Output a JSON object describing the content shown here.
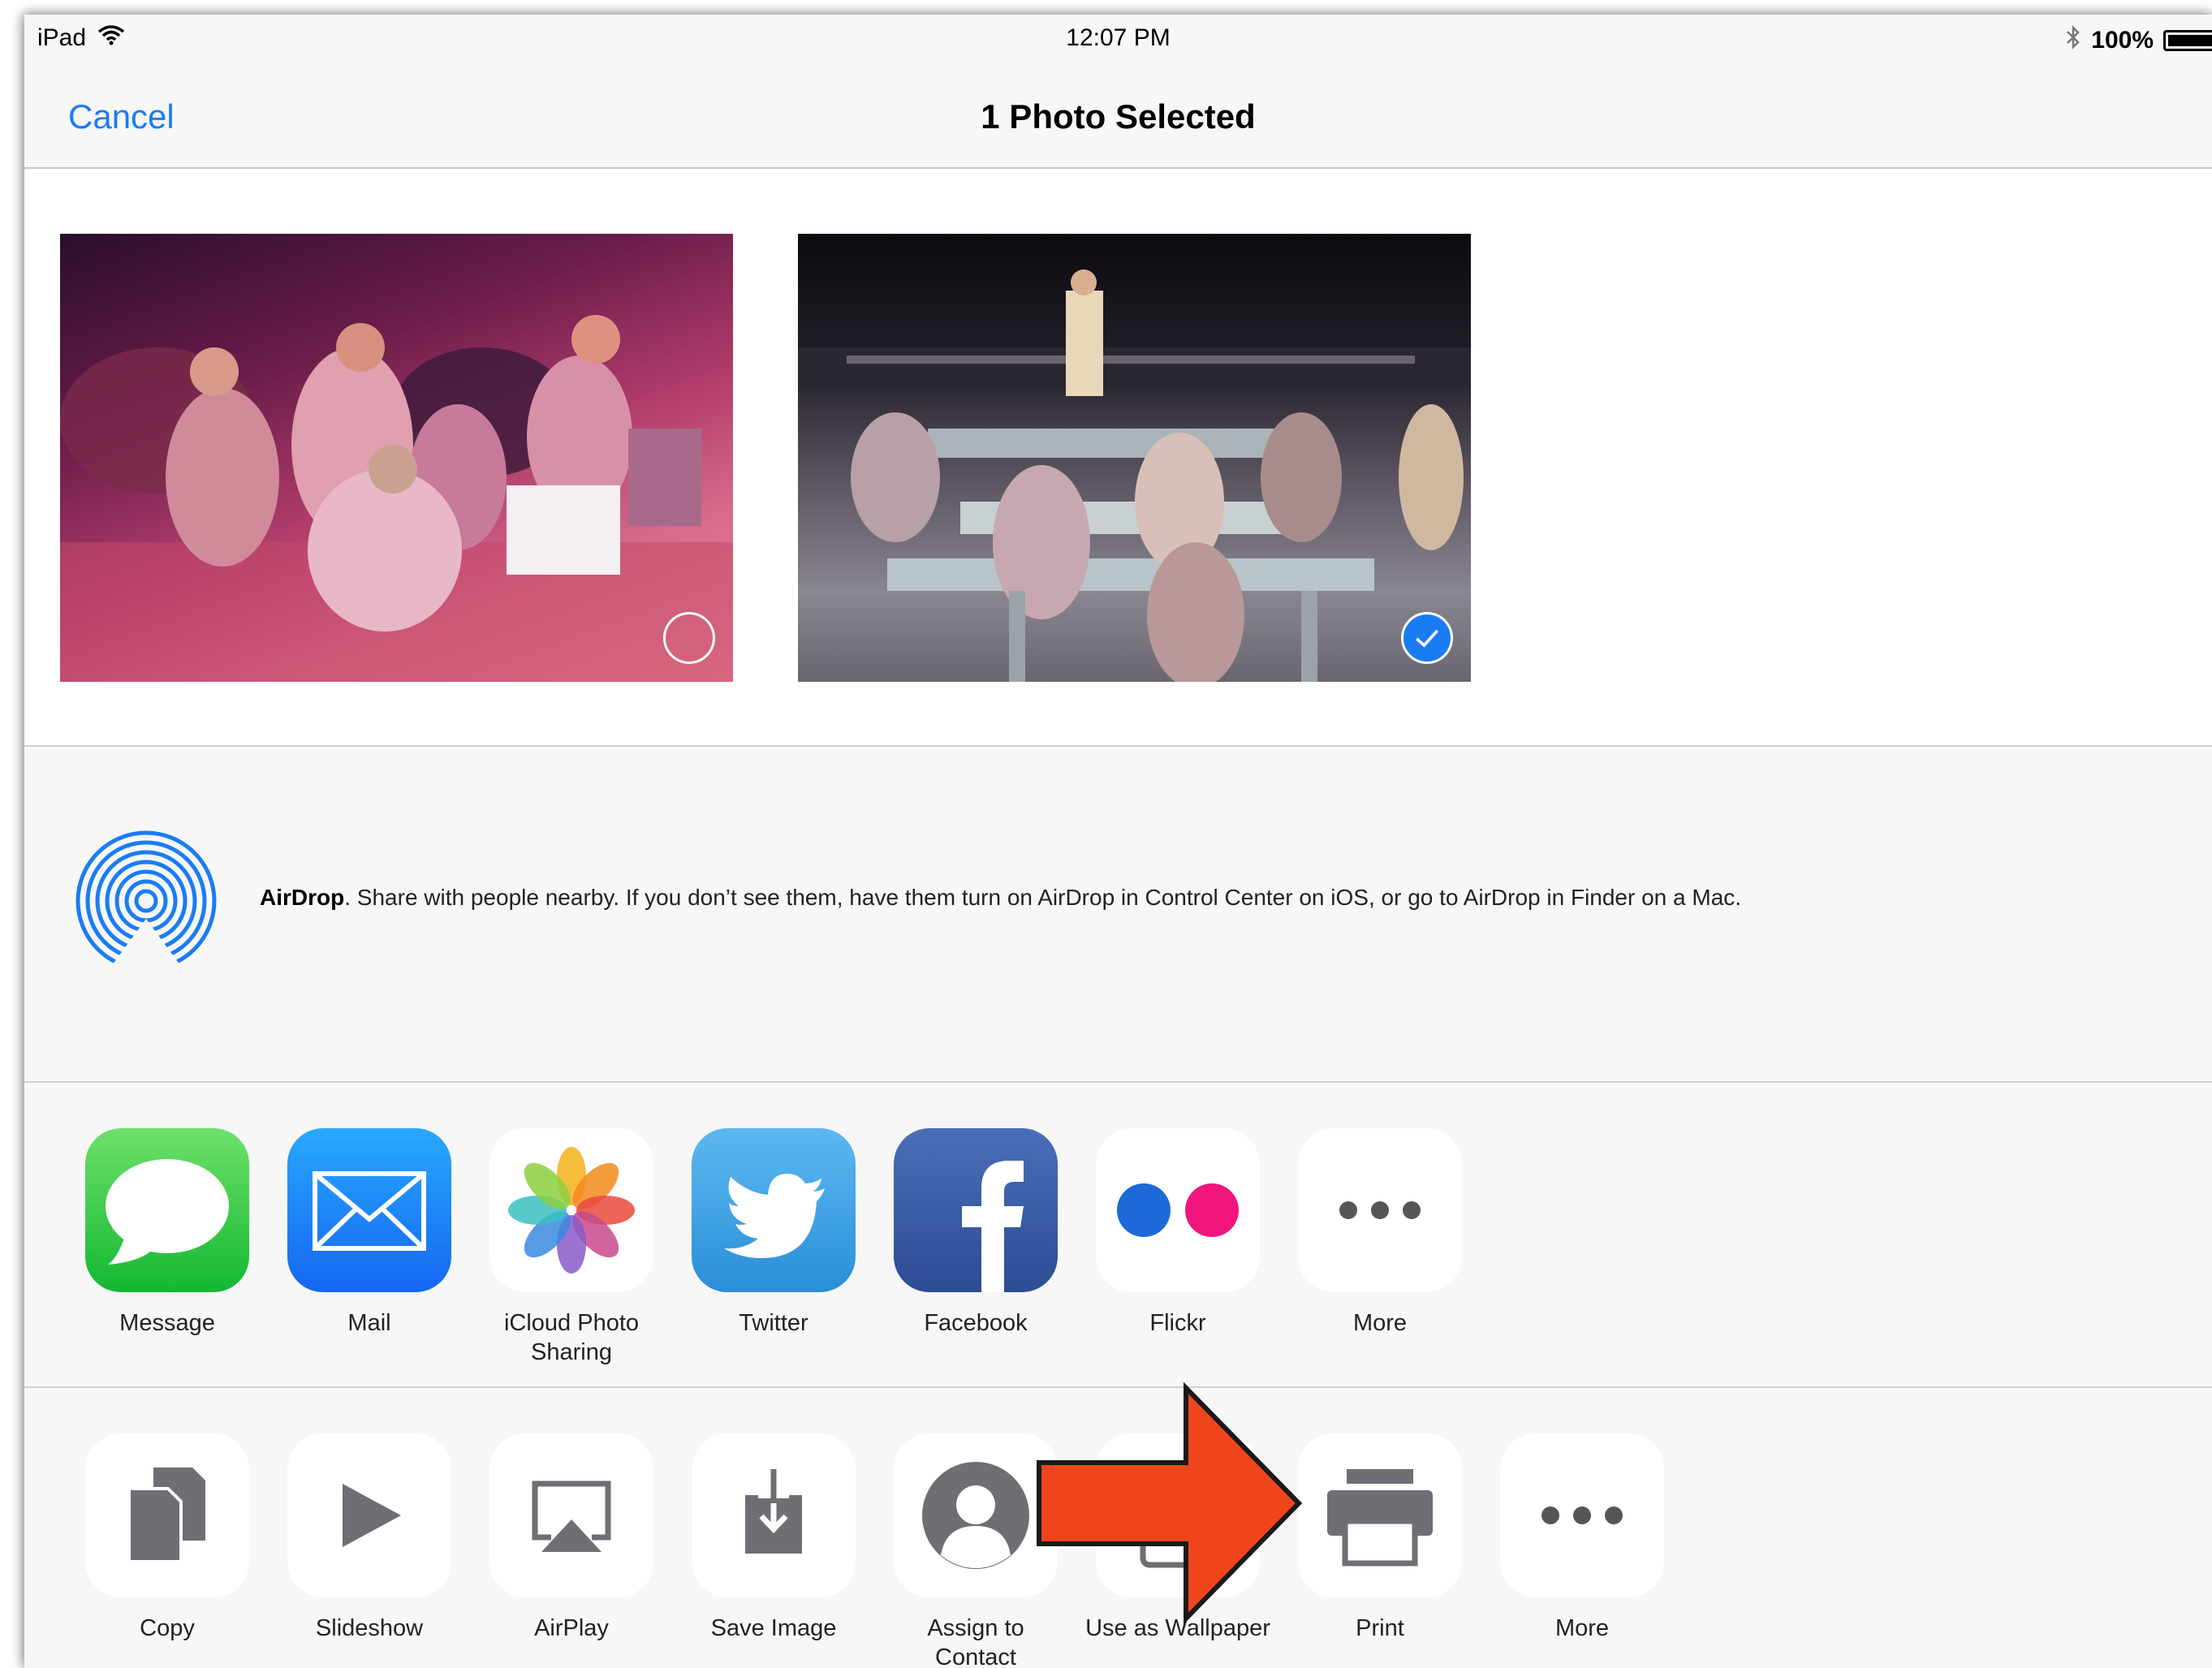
{
  "status_bar": {
    "device": "iPad",
    "time": "12:07 PM",
    "battery": "100%"
  },
  "nav": {
    "cancel_label": "Cancel",
    "title": "1 Photo Selected"
  },
  "photos": [
    {
      "selected": false
    },
    {
      "selected": true
    }
  ],
  "airdrop": {
    "title": "AirDrop",
    "description": ". Share with people nearby. If you don’t see them, have them turn on AirDrop in Control Center on iOS, or go to AirDrop in Finder on a Mac."
  },
  "share_row": [
    {
      "label": "Message",
      "icon": "message-icon"
    },
    {
      "label": "Mail",
      "icon": "mail-icon"
    },
    {
      "label": "iCloud Photo\nSharing",
      "icon": "icloud-photo-sharing-icon"
    },
    {
      "label": "Twitter",
      "icon": "twitter-icon"
    },
    {
      "label": "Facebook",
      "icon": "facebook-icon"
    },
    {
      "label": "Flickr",
      "icon": "flickr-icon"
    },
    {
      "label": "More",
      "icon": "more-icon"
    }
  ],
  "action_row": [
    {
      "label": "Copy",
      "icon": "copy-icon"
    },
    {
      "label": "Slideshow",
      "icon": "play-icon"
    },
    {
      "label": "AirPlay",
      "icon": "airplay-icon"
    },
    {
      "label": "Save Image",
      "icon": "save-image-icon"
    },
    {
      "label": "Assign to\nContact",
      "icon": "contact-icon"
    },
    {
      "label": "Use as Wallpaper",
      "icon": "wallpaper-icon"
    },
    {
      "label": "Print",
      "icon": "print-icon"
    },
    {
      "label": "More",
      "icon": "more-icon"
    }
  ],
  "colors": {
    "accent": "#1a7cf5",
    "annotation_arrow": "#f0451c"
  }
}
